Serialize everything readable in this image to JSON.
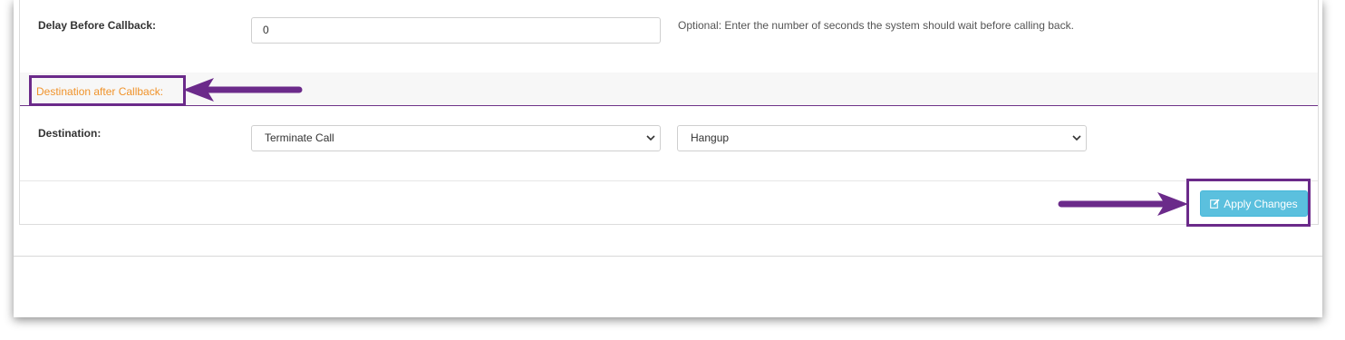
{
  "form": {
    "delay": {
      "label": "Delay Before Callback:",
      "value": "0",
      "help": "Optional: Enter the number of seconds the system should wait before calling back."
    },
    "section": {
      "title": "Destination after Callback:"
    },
    "destination": {
      "label": "Destination:",
      "type_selected": "Terminate Call",
      "target_selected": "Hangup"
    },
    "apply_label": "Apply Changes"
  },
  "colors": {
    "section_title": "#f0932b",
    "highlight": "#6b2a8a",
    "apply_button": "#5bc0de"
  },
  "icons": {
    "apply": "edit-icon",
    "select": "chevron-down-icon"
  }
}
